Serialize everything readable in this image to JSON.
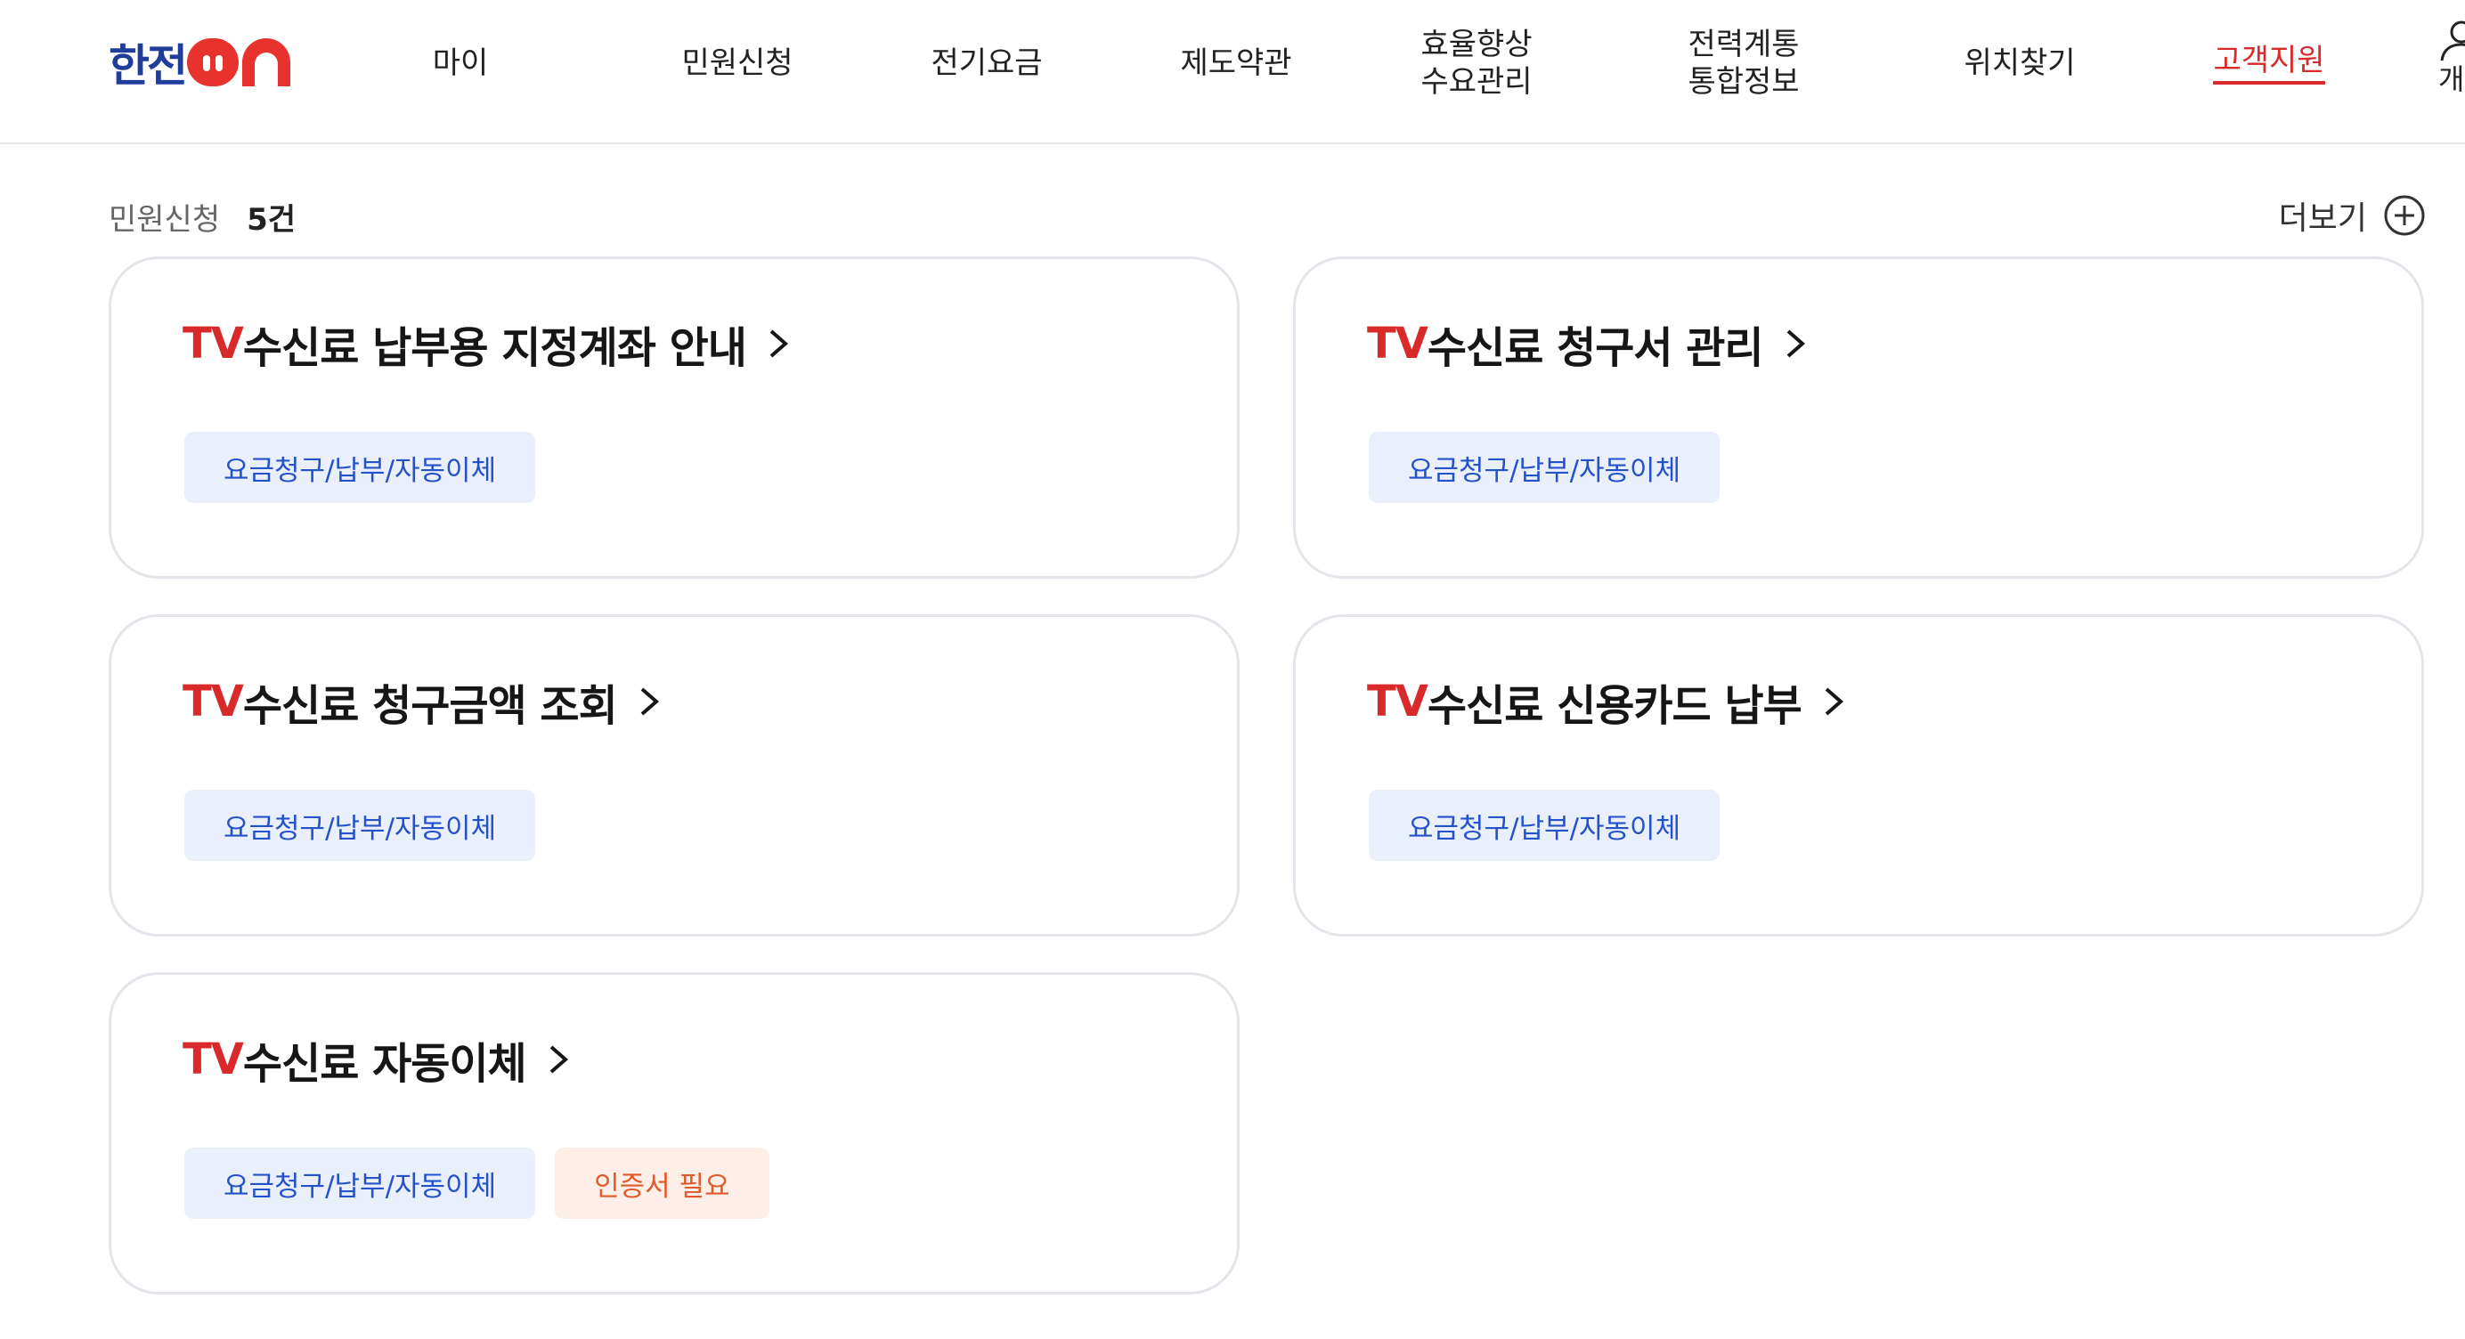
{
  "header": {
    "logo": "한전",
    "nav": [
      {
        "label": "마이"
      },
      {
        "label": "민원신청"
      },
      {
        "label": "전기요금"
      },
      {
        "label": "제도약관"
      },
      {
        "line1": "효율향상",
        "line2": "수요관리"
      },
      {
        "line1": "전력계통",
        "line2": "통합정보"
      },
      {
        "label": "위치찾기"
      },
      {
        "label": "고객지원"
      }
    ],
    "user_label": "개",
    "active_color": "#d82a2a",
    "logo_blue": "#1f3e9b",
    "logo_red": "#e8322e"
  },
  "section": {
    "label": "민원신청",
    "count": "5건",
    "more_label": "더보기"
  },
  "cards": [
    {
      "prefix": "TV",
      "title": "수신료 납부용 지정계좌 안내",
      "tags": [
        "요금청구/납부/자동이체"
      ]
    },
    {
      "prefix": "TV",
      "title": "수신료 청구서 관리",
      "tags": [
        "요금청구/납부/자동이체"
      ]
    },
    {
      "prefix": "TV",
      "title": "수신료 청구금액 조회",
      "tags": [
        "요금청구/납부/자동이체"
      ]
    },
    {
      "prefix": "TV",
      "title": "수신료 신용카드 납부",
      "tags": [
        "요금청구/납부/자동이체"
      ]
    },
    {
      "prefix": "TV",
      "title": "수신료 자동이체",
      "tags": [
        "요금청구/납부/자동이체",
        "인증서 필요"
      ]
    }
  ]
}
